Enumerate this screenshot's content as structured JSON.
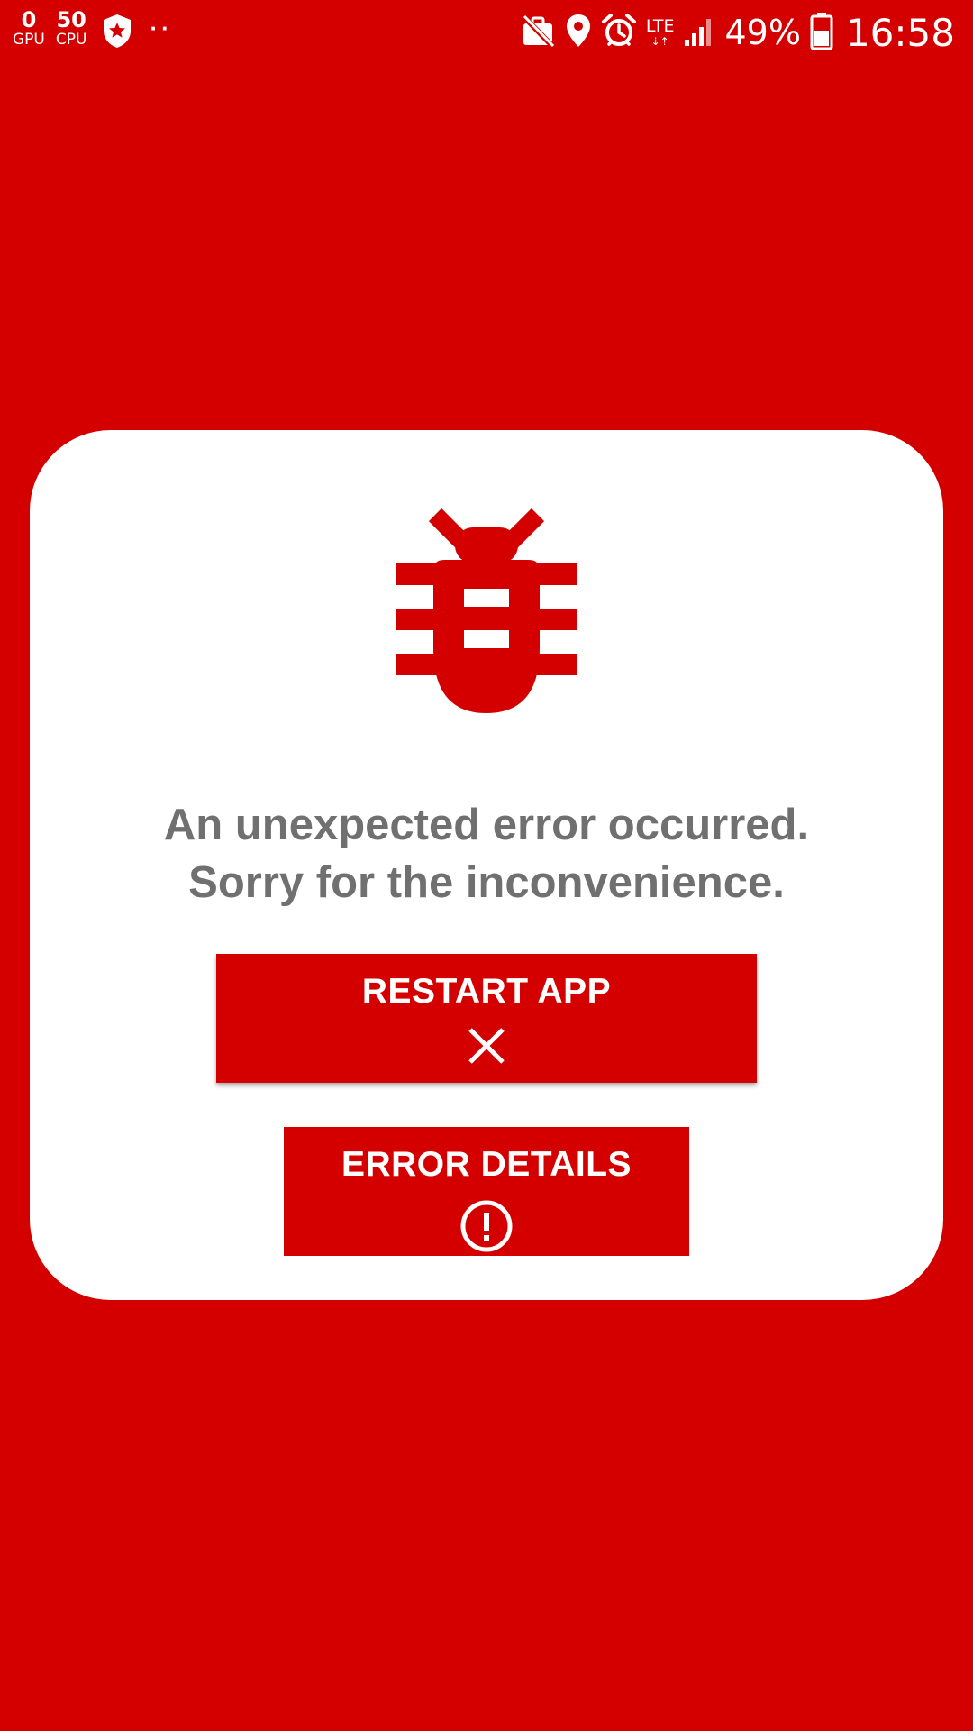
{
  "status_bar": {
    "gpu_value": "0",
    "gpu_label": "GPU",
    "cpu_value": "50",
    "cpu_label": "CPU",
    "more_dots": "··",
    "network_type": "LTE",
    "network_arrows": "⇣⇡",
    "battery_percent": "49%",
    "time": "16:58",
    "icons": [
      "shield-star-icon",
      "work-off-icon",
      "location-icon",
      "alarm-icon",
      "signal-icon",
      "battery-icon"
    ]
  },
  "error_screen": {
    "icon": "bug-icon",
    "message_line1": "An unexpected error occurred.",
    "message_line2": "Sorry for the inconvenience.",
    "restart_button": {
      "label": "RESTART APP",
      "icon": "close-icon"
    },
    "details_button": {
      "label": "ERROR DETAILS",
      "icon": "alert-circle-icon"
    }
  },
  "colors": {
    "background": "#d40000",
    "card": "#ffffff",
    "message_text": "#707070",
    "button": "#d40000",
    "button_text": "#ffffff"
  }
}
